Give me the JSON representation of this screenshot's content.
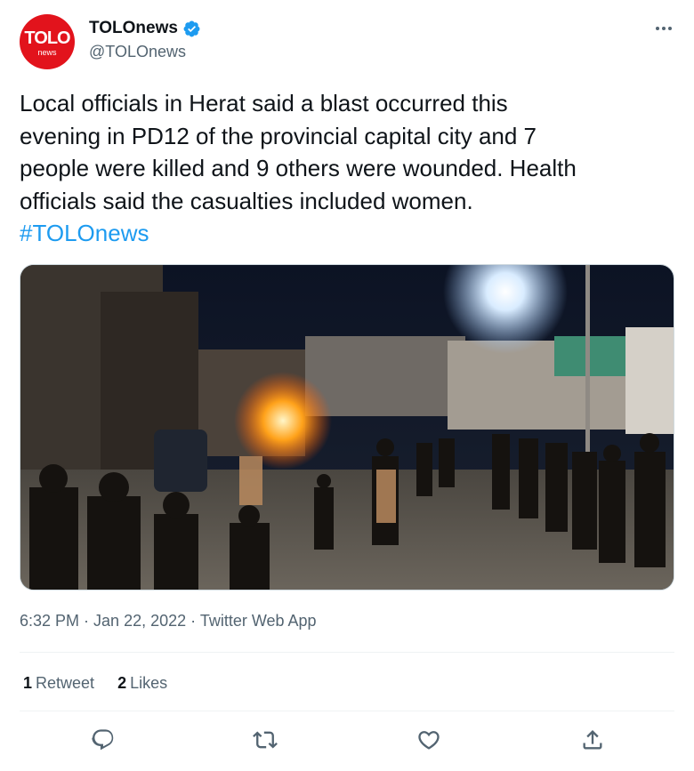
{
  "author": {
    "avatar_text": "TOLO",
    "avatar_subtext": "news",
    "display_name": "TOLOnews",
    "handle": "@TOLOnews",
    "verified": true
  },
  "tweet": {
    "lines": [
      "Local officials in Herat said a blast occurred this",
      "evening in PD12 of the provincial capital city and 7",
      "people were killed and 9 others were wounded. Health",
      "officials said the casualties included women."
    ],
    "hashtag": "#TOLOnews"
  },
  "media": {
    "icon": "photo"
  },
  "meta": {
    "time": "6:32 PM",
    "date": "Jan 22, 2022",
    "source": "Twitter Web App",
    "separator": " · "
  },
  "stats": {
    "retweets_count": "1",
    "retweets_label": "Retweet",
    "likes_count": "2",
    "likes_label": "Likes"
  },
  "actions": [
    "reply-icon",
    "retweet-icon",
    "like-icon",
    "share-icon"
  ],
  "colors": {
    "brand_red": "#e2131c",
    "link_blue": "#1d9bf0",
    "secondary_text": "#536471",
    "verified_blue": "#1d9bf0"
  }
}
